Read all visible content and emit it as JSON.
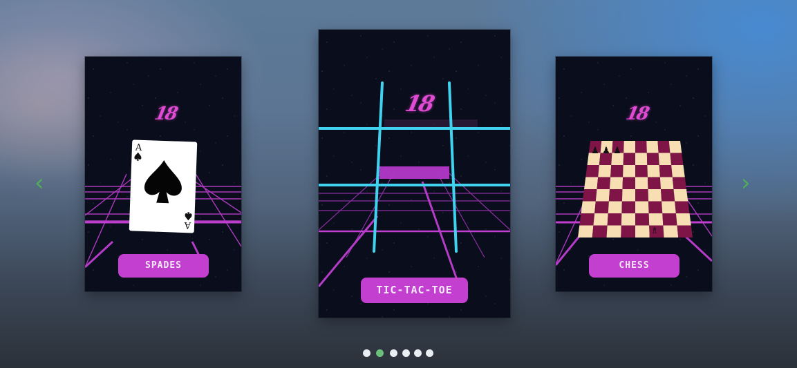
{
  "carousel": {
    "prev_arrow": "‹",
    "next_arrow": "›",
    "arrow_color": "#4fae5c",
    "active_dot_index": 1,
    "dot_count": 6,
    "dot_color": "#e9eef3",
    "active_dot_color": "#6cc07c"
  },
  "cards": [
    {
      "logo": "18",
      "button_label": "SPADES",
      "art": "ace-of-spades",
      "card_rank": "A"
    },
    {
      "logo": "18",
      "button_label": "TIC-TAC-TOE",
      "art": "tic-tac-toe-grid"
    },
    {
      "logo": "18",
      "button_label": "CHESS",
      "art": "chess-board"
    }
  ],
  "colors": {
    "neon_pink": "#e04bd3",
    "neon_cyan": "#3fd3ef",
    "button": "#c23fcf",
    "chess_dark": "#7e1546",
    "chess_light": "#f7dfb3"
  }
}
